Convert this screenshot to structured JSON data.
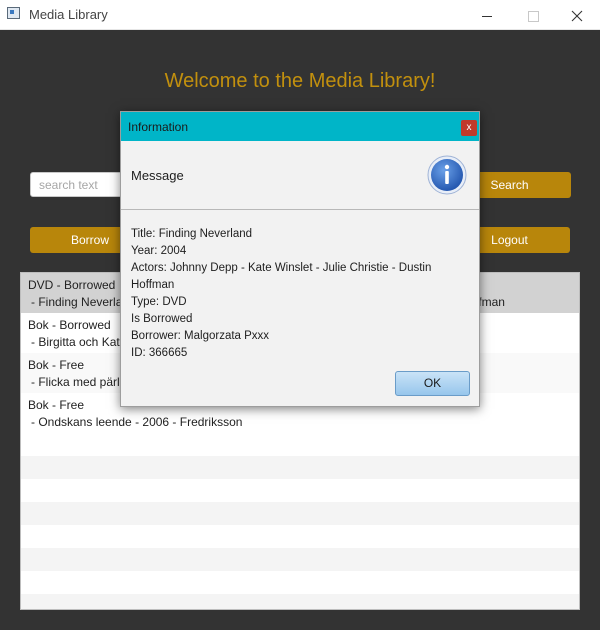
{
  "window": {
    "title": "Media Library",
    "icon": "app-window-icon"
  },
  "main": {
    "welcome": "Welcome to the Media Library!",
    "search_placeholder": "search text",
    "search_label": "Search",
    "borrow_label": "Borrow",
    "logout_label": "Logout"
  },
  "list": {
    "items": [
      {
        "line1": "DVD - Borrowed",
        "line2": " - Finding Neverland - 2004 - Johnny Depp - Kate Winslet - Julie Christie - Dustin Hoffman",
        "selected": true
      },
      {
        "line1": "Bok - Borrowed",
        "line2": " - Birgitta och Katarina"
      },
      {
        "line1": "Bok - Free",
        "line2": " - Flicka med pärlörhänge"
      },
      {
        "line1": "Bok - Free",
        "line2": " - Ondskans leende - 2006 - Fredriksson"
      }
    ]
  },
  "dialog": {
    "title": "Information",
    "close_glyph": "x",
    "header": "Message",
    "icon": "information-icon",
    "lines": [
      "Title: Finding Neverland",
      "Year: 2004",
      "Actors: Johnny Depp - Kate Winslet - Julie Christie - Dustin Hoffman",
      "Type: DVD",
      "Is Borrowed",
      "Borrower: Malgorzata Pxxx",
      "ID: 366665"
    ],
    "ok_label": "OK"
  },
  "colors": {
    "accent": "#b8860b",
    "welcome_text": "#c2900e",
    "dialog_titlebar": "#00b5c8",
    "background": "#333333"
  }
}
